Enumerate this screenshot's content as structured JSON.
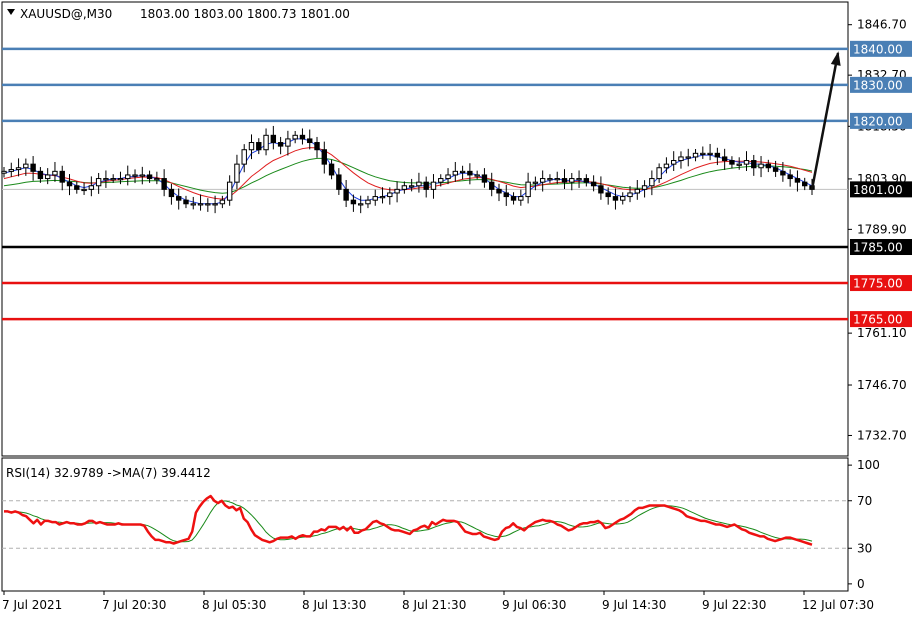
{
  "header": {
    "symbol": "XAUUSD@,M30",
    "ohlc": "1803.00 1803.00 1800.73 1801.00"
  },
  "rsi_header": {
    "label": "RSI(14) 32.9789 ->MA(7) 39.4412"
  },
  "colors": {
    "resistance": "#4a7fb5",
    "pivot": "#000000",
    "support": "#e81010",
    "ma_fast": "#1f3fe0",
    "ma_mid": "#e02020",
    "ma_slow": "#1a8a1a",
    "rsi": "#ee1111",
    "rsi_ma": "#1a8a1a",
    "arrow": "#111111"
  },
  "chart_data": [
    {
      "type": "candlestick",
      "ylim": [
        1727.0,
        1853.0
      ],
      "price_ticks": [
        "1846.70",
        "1832.70",
        "1818.50",
        "1803.90",
        "1789.90",
        "1761.10",
        "1746.70",
        "1732.70"
      ],
      "price_tick_values": [
        1846.7,
        1832.7,
        1818.5,
        1803.9,
        1789.9,
        1761.1,
        1746.7,
        1732.7
      ],
      "x_labels": [
        "7 Jul 2021",
        "7 Jul 20:30",
        "8 Jul 05:30",
        "8 Jul 13:30",
        "8 Jul 21:30",
        "9 Jul 06:30",
        "9 Jul 14:30",
        "9 Jul 22:30",
        "12 Jul 07:30"
      ],
      "levels": [
        {
          "label": "1840.00",
          "value": 1840.0,
          "kind": "resistance"
        },
        {
          "label": "1830.00",
          "value": 1830.0,
          "kind": "resistance"
        },
        {
          "label": "1820.00",
          "value": 1820.0,
          "kind": "resistance"
        },
        {
          "label": "1785.00",
          "value": 1785.0,
          "kind": "pivot"
        },
        {
          "label": "1775.00",
          "value": 1775.0,
          "kind": "support"
        },
        {
          "label": "1765.00",
          "value": 1765.0,
          "kind": "support"
        }
      ],
      "current_price": {
        "label": "1801.00",
        "value": 1801.0
      },
      "close_path": [
        1806,
        1806.5,
        1807,
        1808,
        1806,
        1804,
        1805,
        1806,
        1803,
        1802,
        1801,
        1801,
        1802,
        1804,
        1804,
        1804,
        1804,
        1805,
        1805,
        1805,
        1804,
        1804,
        1801,
        1799,
        1798,
        1797,
        1797,
        1797,
        1797,
        1797,
        1798,
        1803,
        1808,
        1812,
        1814,
        1812,
        1816,
        1814,
        1813,
        1815,
        1816,
        1815,
        1814,
        1812,
        1808,
        1805,
        1801,
        1798,
        1797,
        1797,
        1798,
        1799,
        1799,
        1800,
        1801,
        1802,
        1802,
        1803,
        1801,
        1803,
        1804,
        1805,
        1806,
        1806,
        1805,
        1805,
        1803,
        1801,
        1800,
        1799,
        1798,
        1799,
        1803,
        1803,
        1804,
        1804,
        1804,
        1803,
        1804,
        1804,
        1803,
        1802,
        1800,
        1799,
        1798,
        1799,
        1800,
        1801,
        1802,
        1804,
        1807,
        1808,
        1809,
        1810,
        1810,
        1811,
        1811,
        1811,
        1810,
        1809,
        1808,
        1808,
        1809,
        1807,
        1808,
        1807,
        1806,
        1805,
        1804,
        1803,
        1802,
        1801
      ],
      "ma_fast": [
        1805.5,
        1806,
        1806.5,
        1807,
        1806.5,
        1805.5,
        1805,
        1805,
        1804,
        1803,
        1802,
        1801.5,
        1802,
        1803,
        1803.5,
        1804,
        1804,
        1804.5,
        1804.5,
        1805,
        1804.5,
        1804,
        1802.5,
        1800.5,
        1799,
        1798,
        1797.5,
        1797,
        1797,
        1797,
        1797.5,
        1800,
        1804,
        1808,
        1811,
        1812,
        1813.5,
        1814,
        1813.5,
        1814,
        1815,
        1815,
        1814.5,
        1813,
        1810.5,
        1807.5,
        1804,
        1801,
        1799,
        1798,
        1798,
        1798.5,
        1799,
        1799.5,
        1800.5,
        1801,
        1801.5,
        1802,
        1802,
        1802.5,
        1803,
        1804,
        1805,
        1805.5,
        1805.5,
        1805,
        1804,
        1802.5,
        1801,
        1800,
        1799,
        1799,
        1800.5,
        1802,
        1803,
        1803.5,
        1804,
        1803.5,
        1803.5,
        1803.5,
        1803,
        1802.5,
        1801.5,
        1800.5,
        1799.5,
        1799,
        1799.5,
        1800,
        1801,
        1802.5,
        1804.5,
        1806.5,
        1808,
        1809,
        1809.5,
        1810,
        1810.5,
        1810.5,
        1810,
        1809.5,
        1809,
        1808.5,
        1808.5,
        1808,
        1808,
        1807.5,
        1807,
        1806,
        1805,
        1804,
        1803,
        1802
      ],
      "ma_mid": [
        1804,
        1804.5,
        1805,
        1805.5,
        1805.5,
        1805.2,
        1805,
        1804.8,
        1804.4,
        1803.9,
        1803.3,
        1802.8,
        1802.7,
        1802.9,
        1803.2,
        1803.5,
        1803.7,
        1804,
        1804.2,
        1804.4,
        1804.4,
        1804.3,
        1803.7,
        1802.8,
        1801.8,
        1800.9,
        1800.1,
        1799.4,
        1798.9,
        1798.5,
        1798.3,
        1799,
        1800.6,
        1802.6,
        1804.6,
        1806.1,
        1807.7,
        1809,
        1809.9,
        1810.8,
        1811.7,
        1812.3,
        1812.6,
        1812.5,
        1811.8,
        1810.6,
        1809,
        1807.3,
        1805.6,
        1804.1,
        1802.8,
        1801.9,
        1801.2,
        1800.9,
        1800.8,
        1800.9,
        1801.1,
        1801.4,
        1801.5,
        1801.8,
        1802.2,
        1802.7,
        1803.3,
        1803.8,
        1804.1,
        1804.3,
        1804.2,
        1803.8,
        1803.2,
        1802.6,
        1801.9,
        1801.5,
        1801.7,
        1801.9,
        1802.3,
        1802.6,
        1802.9,
        1803,
        1803.1,
        1803.2,
        1803.2,
        1803,
        1802.6,
        1802.1,
        1801.5,
        1801.1,
        1800.9,
        1800.9,
        1801,
        1801.4,
        1802.2,
        1803.1,
        1804.1,
        1805.1,
        1806,
        1806.9,
        1807.6,
        1808.2,
        1808.5,
        1808.7,
        1808.8,
        1808.8,
        1808.8,
        1808.7,
        1808.6,
        1808.4,
        1808.1,
        1807.8,
        1807.4,
        1806.9,
        1806.3,
        1805.7
      ],
      "ma_slow": [
        1802,
        1802.3,
        1802.6,
        1803,
        1803.2,
        1803.3,
        1803.4,
        1803.5,
        1803.4,
        1803.3,
        1803.1,
        1802.9,
        1802.8,
        1802.8,
        1802.9,
        1803,
        1803.1,
        1803.2,
        1803.3,
        1803.4,
        1803.4,
        1803.4,
        1803.2,
        1802.8,
        1802.3,
        1801.8,
        1801.3,
        1800.8,
        1800.4,
        1800.1,
        1799.9,
        1800.1,
        1800.8,
        1801.7,
        1802.8,
        1803.7,
        1804.8,
        1805.7,
        1806.5,
        1807.3,
        1808.1,
        1808.8,
        1809.3,
        1809.6,
        1809.6,
        1809.3,
        1808.7,
        1807.9,
        1807,
        1806.1,
        1805.2,
        1804.5,
        1803.9,
        1803.4,
        1803.1,
        1802.9,
        1802.8,
        1802.8,
        1802.7,
        1802.7,
        1802.8,
        1803,
        1803.2,
        1803.4,
        1803.6,
        1803.7,
        1803.7,
        1803.6,
        1803.3,
        1803,
        1802.6,
        1802.3,
        1802.2,
        1802.2,
        1802.3,
        1802.4,
        1802.5,
        1802.6,
        1802.7,
        1802.8,
        1802.8,
        1802.7,
        1802.5,
        1802.2,
        1801.9,
        1801.6,
        1801.4,
        1801.3,
        1801.3,
        1801.4,
        1801.8,
        1802.3,
        1802.9,
        1803.5,
        1804.2,
        1804.8,
        1805.4,
        1805.9,
        1806.3,
        1806.6,
        1806.9,
        1807.1,
        1807.3,
        1807.4,
        1807.5,
        1807.5,
        1807.4,
        1807.3,
        1807.1,
        1806.8,
        1806.5,
        1806.1
      ]
    },
    {
      "type": "line",
      "ylim": [
        -6,
        106
      ],
      "rsi_ticks": [
        "100",
        "70",
        "30",
        "0"
      ],
      "rsi_tick_values": [
        100,
        70,
        30,
        0
      ],
      "dashed_levels": [
        70,
        30
      ],
      "rsi": [
        61,
        61,
        60,
        61,
        60,
        58,
        57,
        54,
        51,
        54,
        50,
        53,
        53,
        52,
        52,
        50,
        51,
        52,
        51,
        51,
        50,
        50,
        51,
        53,
        53,
        51,
        52,
        51,
        50,
        50,
        50,
        51,
        50,
        50,
        50,
        50,
        50,
        50,
        49,
        44,
        40,
        37,
        37,
        36,
        35,
        35,
        34,
        35,
        36,
        37,
        38,
        44,
        60,
        65,
        69,
        72,
        74,
        70,
        68,
        70,
        66,
        64,
        65,
        62,
        64,
        55,
        52,
        46,
        41,
        39,
        37,
        36,
        35,
        36,
        38,
        39,
        39,
        39,
        40,
        38,
        40,
        41,
        40,
        40,
        44,
        44,
        46,
        45,
        48,
        48,
        48,
        46,
        48,
        45,
        48,
        43,
        43,
        45,
        46,
        49,
        52,
        53,
        51,
        50,
        48,
        46,
        45,
        45,
        44,
        43,
        42,
        45,
        46,
        48,
        49,
        47,
        52,
        50,
        52,
        54,
        53,
        53,
        53,
        52,
        48,
        44,
        43,
        42,
        42,
        43,
        40,
        39,
        38,
        37,
        38,
        44,
        47,
        48,
        51,
        48,
        47,
        45,
        48,
        50,
        52,
        53,
        54,
        53,
        53,
        52,
        50,
        49,
        47,
        45,
        46,
        48,
        50,
        51,
        51,
        52,
        52,
        53,
        51,
        47,
        48,
        50,
        52,
        54,
        55,
        57,
        59,
        62,
        64,
        64,
        65,
        66,
        66,
        66,
        66,
        66,
        65,
        64,
        63,
        62,
        60,
        57,
        56,
        55,
        54,
        53,
        53,
        52,
        51,
        50,
        50,
        49,
        48,
        49,
        50,
        48,
        46,
        45,
        43,
        42,
        41,
        40,
        40,
        38,
        37,
        36,
        37,
        38,
        39,
        39,
        38,
        37,
        36,
        35,
        34,
        33
      ]
    }
  ]
}
